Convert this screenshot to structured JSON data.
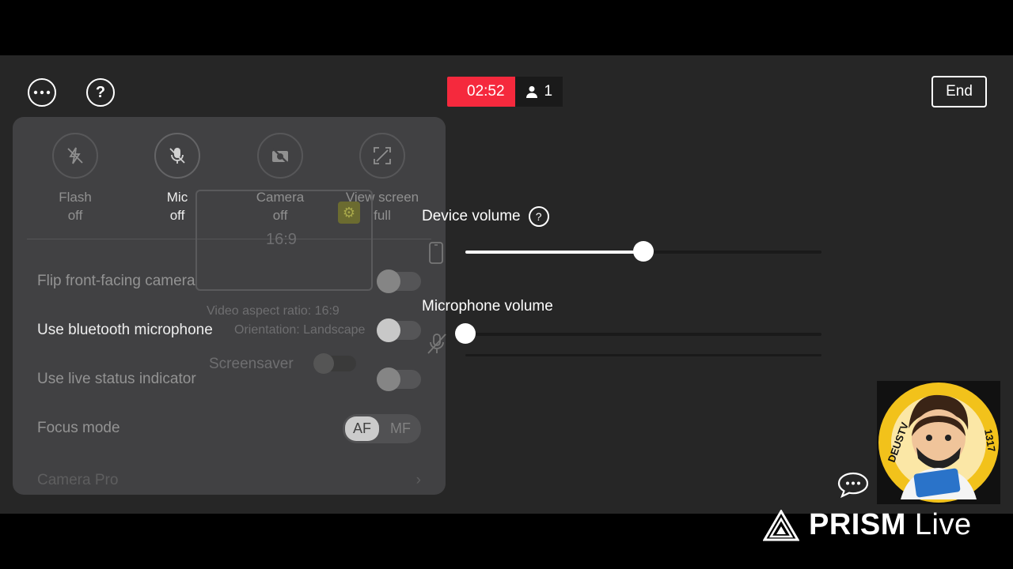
{
  "header": {
    "more_icon": "more-horizontal-icon",
    "help_icon": "help-icon",
    "timer": "02:52",
    "viewers": "1",
    "end_label": "End"
  },
  "quick_actions": [
    {
      "icon": "flash-off-icon",
      "line1": "Flash",
      "line2": "off"
    },
    {
      "icon": "mic-off-icon",
      "line1": "Mic",
      "line2": "off"
    },
    {
      "icon": "camera-off-icon",
      "line1": "Camera",
      "line2": "off"
    },
    {
      "icon": "fullscreen-icon",
      "line1": "View screen",
      "line2": "full"
    }
  ],
  "settings": {
    "flip_camera": "Flip front-facing camera",
    "bluetooth_mic": "Use bluetooth microphone",
    "live_status": "Use live status indicator",
    "focus_mode": "Focus mode",
    "focus_af": "AF",
    "focus_mf": "MF",
    "camera_pro": "Camera Pro"
  },
  "ghost_overlay": {
    "ratio": "16:9",
    "aspect_line": "Video aspect ratio: 16:9",
    "orientation_line": "Orientation: Landscape",
    "screensaver": "Screensaver"
  },
  "volume": {
    "device_label": "Device volume",
    "device_level": 0.5,
    "mic_label": "Microphone volume",
    "mic_level": 0.0
  },
  "branding": {
    "avatar_text_left": "DEUSTV",
    "avatar_text_right": "1317",
    "prism_bold": "PRISM",
    "prism_light": "Live"
  },
  "colors": {
    "timer_red": "#f5293d",
    "panel": "#444446",
    "stage": "#262626"
  }
}
